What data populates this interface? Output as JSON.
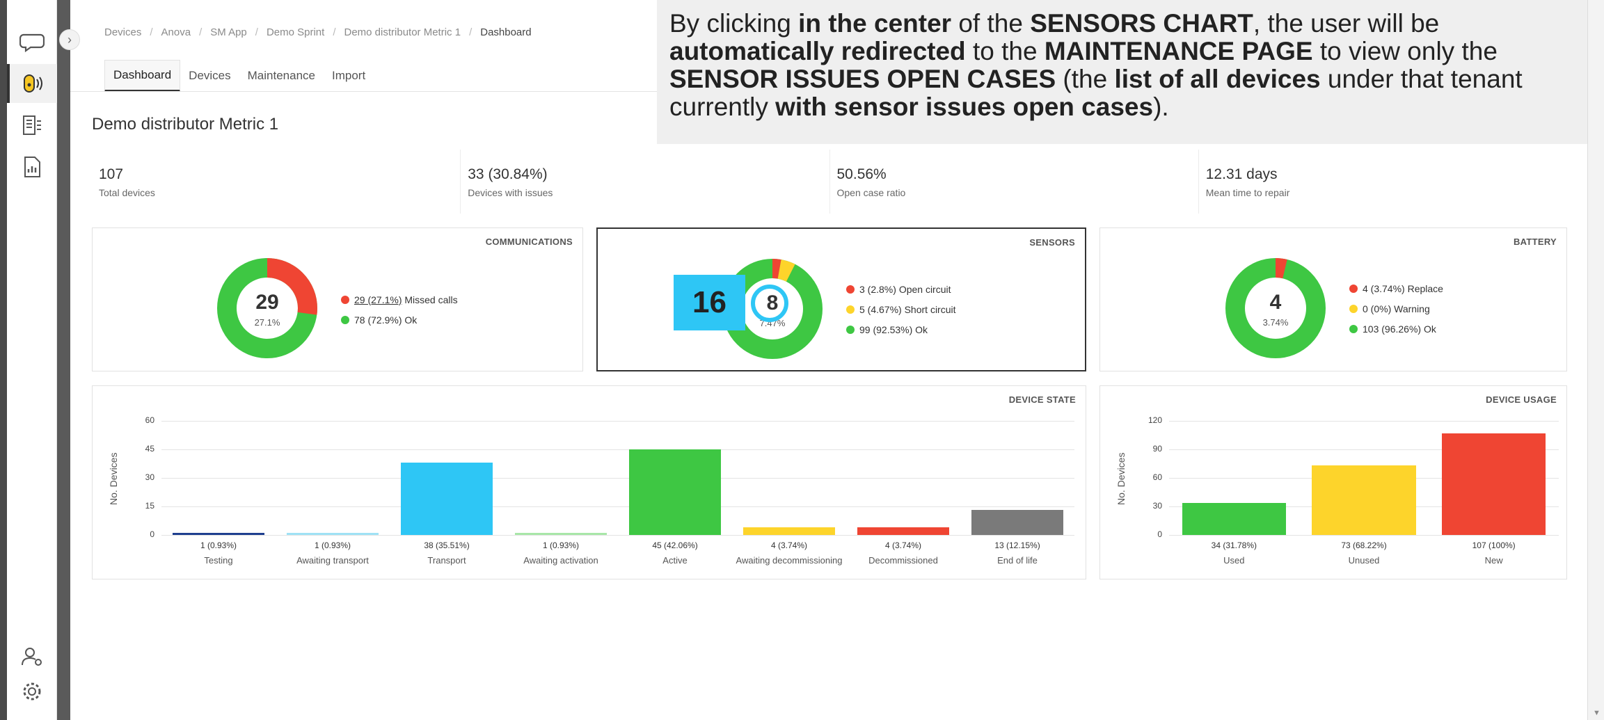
{
  "breadcrumb": [
    "Devices",
    "Anova",
    "SM App",
    "Demo Sprint",
    "Demo distributor Metric 1",
    "Dashboard"
  ],
  "tabs": [
    "Dashboard",
    "Devices",
    "Maintenance",
    "Import"
  ],
  "page_title": "Demo distributor Metric 1",
  "kpis": [
    {
      "value": "107",
      "label": "Total devices"
    },
    {
      "value": "33 (30.84%)",
      "label": "Devices with issues"
    },
    {
      "value": "50.56%",
      "label": "Open case ratio"
    },
    {
      "value": "12.31 days",
      "label": "Mean time to repair"
    }
  ],
  "cards": {
    "communications": {
      "title": "COMMUNICATIONS",
      "center_value": "29",
      "center_pct": "27.1%",
      "legend": [
        {
          "value": "29 (27.1%)",
          "label": "Missed calls",
          "color": "#ef4533"
        },
        {
          "value": "78 (72.9%)",
          "label": "Ok",
          "color": "#3ec743"
        }
      ]
    },
    "sensors": {
      "title": "SENSORS",
      "center_value": "8",
      "center_pct": "7.47%",
      "callout": "16",
      "legend": [
        {
          "value": "3 (2.8%)",
          "label": "Open circuit",
          "color": "#ef4533"
        },
        {
          "value": "5 (4.67%)",
          "label": "Short circuit",
          "color": "#fdd42b"
        },
        {
          "value": "99 (92.53%)",
          "label": "Ok",
          "color": "#3ec743"
        }
      ]
    },
    "battery": {
      "title": "BATTERY",
      "center_value": "4",
      "center_pct": "3.74%",
      "legend": [
        {
          "value": "4 (3.74%)",
          "label": "Replace",
          "color": "#ef4533"
        },
        {
          "value": "0 (0%)",
          "label": "Warning",
          "color": "#fdd42b"
        },
        {
          "value": "103 (96.26%)",
          "label": "Ok",
          "color": "#3ec743"
        }
      ]
    },
    "device_state": {
      "title": "DEVICE STATE",
      "ylabel": "No. Devices"
    },
    "device_usage": {
      "title": "DEVICE USAGE",
      "ylabel": "No. Devices"
    }
  },
  "chart_data": [
    {
      "type": "bar",
      "title": "DEVICE STATE",
      "ylabel": "No. Devices",
      "ylim": [
        0,
        60
      ],
      "yticks": [
        "60",
        "45",
        "30",
        "15",
        "0"
      ],
      "categories": [
        "Testing",
        "Awaiting transport",
        "Transport",
        "Awaiting activation",
        "Active",
        "Awaiting decommissioning",
        "Decommissioned",
        "End of life"
      ],
      "values": [
        1,
        1,
        38,
        1,
        45,
        4,
        4,
        13
      ],
      "labels": [
        "1 (0.93%)",
        "1 (0.93%)",
        "38 (35.51%)",
        "1 (0.93%)",
        "45 (42.06%)",
        "4 (3.74%)",
        "4 (3.74%)",
        "13 (12.15%)"
      ],
      "colors": [
        "#1f3f8f",
        "#9fe2f5",
        "#2ec6f5",
        "#a8e6a8",
        "#3ec743",
        "#fdd42b",
        "#ef4533",
        "#7a7a7a"
      ],
      "grid": true
    },
    {
      "type": "bar",
      "title": "DEVICE USAGE",
      "ylabel": "No. Devices",
      "ylim": [
        0,
        120
      ],
      "yticks": [
        "120",
        "90",
        "60",
        "30",
        "0"
      ],
      "categories": [
        "Used",
        "Unused",
        "New"
      ],
      "values": [
        34,
        73,
        107
      ],
      "labels": [
        "34 (31.78%)",
        "73 (68.22%)",
        "107 (100%)"
      ],
      "colors": [
        "#3ec743",
        "#fdd42b",
        "#ef4533"
      ],
      "grid": true
    }
  ],
  "annotation": {
    "p1": "By clicking ",
    "b1": "in the center",
    "p2": " of the ",
    "b2": "SENSORS CHART",
    "p3": ", the user will be ",
    "b3": "automatically redirected",
    "p4": " to the ",
    "b4": "MAINTENANCE PAGE",
    "p5": " to view only the ",
    "b5": "SENSOR ISSUES OPEN CASES",
    "p6": " (the ",
    "b6": "list of all devices",
    "p7": " under that tenant currently ",
    "b7": "with sensor issues open cases",
    "p8": ")."
  }
}
